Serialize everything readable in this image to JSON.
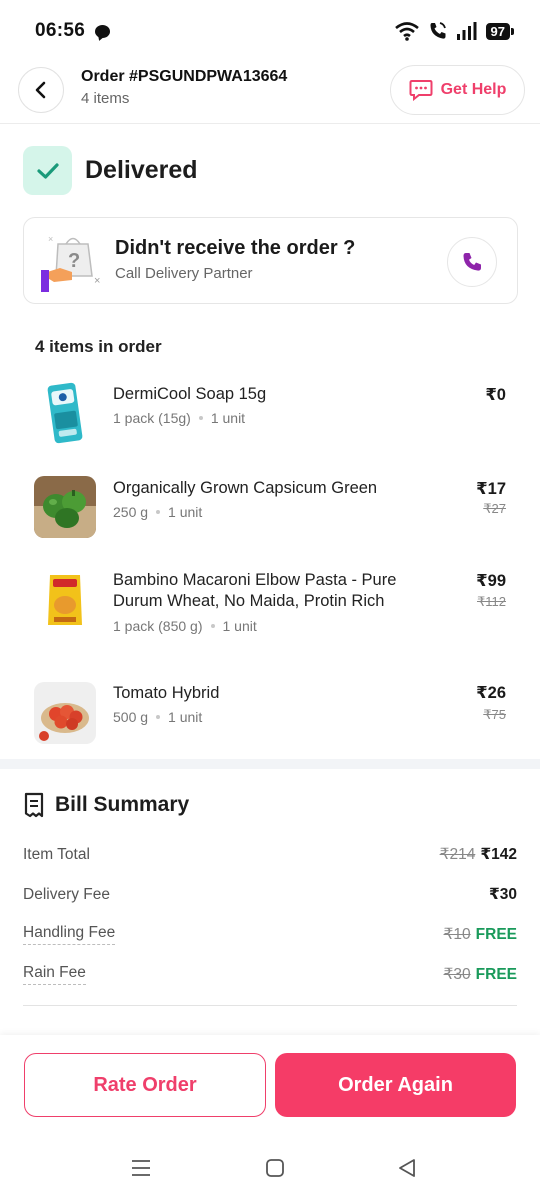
{
  "status_bar": {
    "time": "06:56",
    "battery": "97"
  },
  "header": {
    "order_id": "Order #PSGUNDPWA13664",
    "item_count": "4 items",
    "help_label": "Get Help"
  },
  "status": {
    "label": "Delivered"
  },
  "call_card": {
    "title": "Didn't receive the order ?",
    "subtitle": "Call Delivery Partner"
  },
  "items_heading": "4 items in order",
  "items": [
    {
      "name": "DermiCool Soap 15g",
      "quantity": "1 pack (15g)",
      "units": "1 unit",
      "price": "₹0",
      "mrp": ""
    },
    {
      "name": "Organically Grown Capsicum Green",
      "quantity": "250 g",
      "units": "1 unit",
      "price": "₹17",
      "mrp": "₹27"
    },
    {
      "name": "Bambino Macaroni Elbow Pasta - Pure Durum Wheat, No Maida, Protin Rich",
      "quantity": "1 pack (850 g)",
      "units": "1 unit",
      "price": "₹99",
      "mrp": "₹112"
    },
    {
      "name": "Tomato Hybrid",
      "quantity": "500 g",
      "units": "1 unit",
      "price": "₹26",
      "mrp": "₹75"
    }
  ],
  "bill": {
    "title": "Bill Summary",
    "rows": [
      {
        "label": "Item Total",
        "original": "₹214",
        "value": "₹142"
      },
      {
        "label": "Delivery Fee",
        "original": "",
        "value": "₹30"
      },
      {
        "label": "Handling Fee",
        "original": "₹10",
        "value": "FREE"
      },
      {
        "label": "Rain Fee",
        "original": "₹30",
        "value": "FREE"
      }
    ]
  },
  "actions": {
    "rate": "Rate Order",
    "again": "Order Again"
  },
  "colors": {
    "accent": "#F53C67",
    "success": "#1A9A5B",
    "delivered_bg": "#D5F5EA",
    "call_icon": "#8E24AA"
  }
}
